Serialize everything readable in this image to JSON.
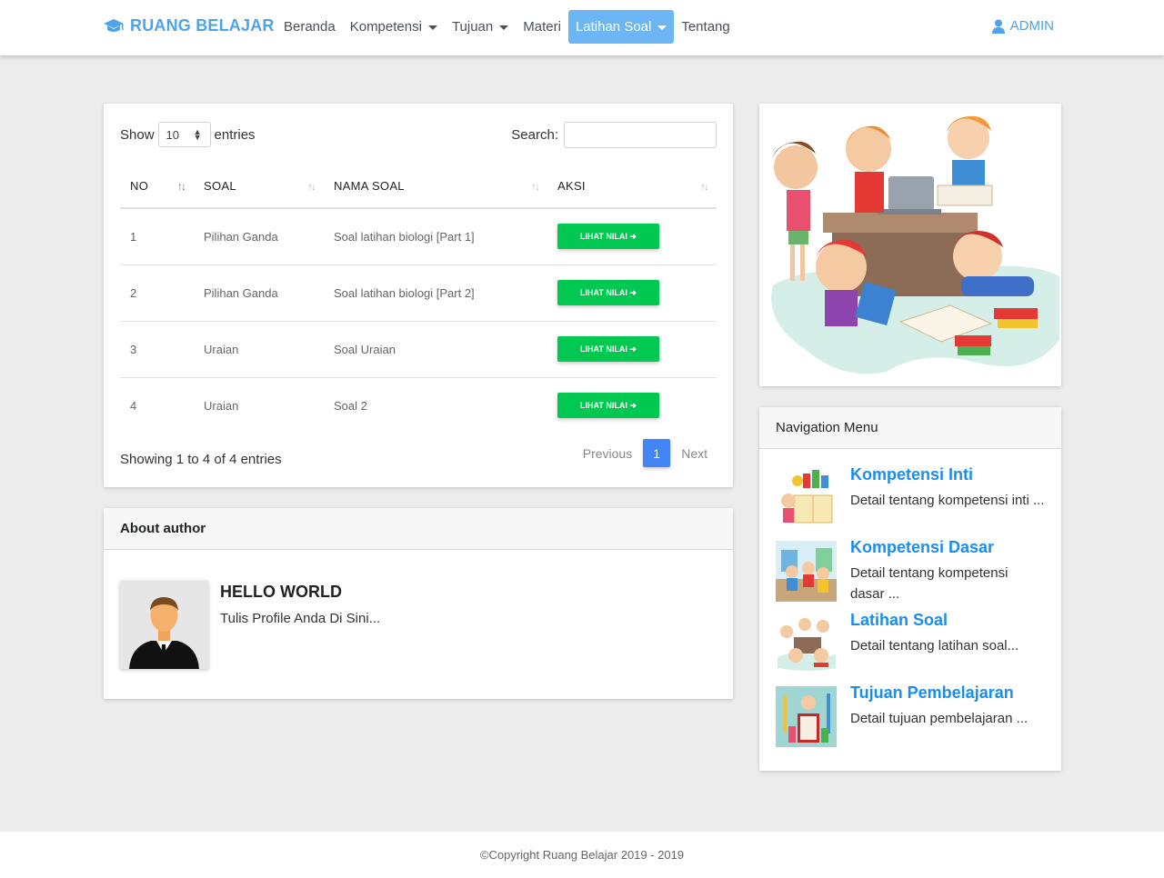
{
  "navbar": {
    "brand": "RUANG BELAJAR",
    "items": [
      {
        "label": "Beranda"
      },
      {
        "label": "Kompetensi"
      },
      {
        "label": "Tujuan"
      },
      {
        "label": "Materi"
      },
      {
        "label": "Latihan Soal"
      },
      {
        "label": "Tentang"
      }
    ],
    "user": "ADMIN"
  },
  "table_card": {
    "show_label": "Show",
    "entries_label": "entries",
    "page_length": "10",
    "search_label": "Search:",
    "search_value": "",
    "columns": [
      "NO",
      "SOAL",
      "NAMA SOAL",
      "AKSI"
    ],
    "rows": [
      {
        "no": "1",
        "soal": "Pilihan Ganda",
        "nama": "Soal latihan biologi [Part 1]",
        "aksi": "LIHAT NILAI"
      },
      {
        "no": "2",
        "soal": "Pilihan Ganda",
        "nama": "Soal latihan biologi [Part 2]",
        "aksi": "LIHAT NILAI"
      },
      {
        "no": "3",
        "soal": "Uraian",
        "nama": "Soal Uraian",
        "aksi": "LIHAT NILAI"
      },
      {
        "no": "4",
        "soal": "Uraian",
        "nama": "Soal 2",
        "aksi": "LIHAT NILAI"
      }
    ],
    "info": "Showing 1 to 4 of 4 entries",
    "pagination": {
      "previous": "Previous",
      "current": "1",
      "next": "Next"
    }
  },
  "author_card": {
    "header": "About author",
    "name": "HELLO WORLD",
    "description": "Tulis Profile Anda Di Sini..."
  },
  "nav_card": {
    "header": "Navigation Menu",
    "items": [
      {
        "title": "Kompetensi Inti",
        "desc": "Detail tentang kompetensi inti ..."
      },
      {
        "title": "Kompetensi Dasar",
        "desc": "Detail tentang kompetensi dasar ..."
      },
      {
        "title": "Latihan Soal",
        "desc": "Detail tentang latihan soal..."
      },
      {
        "title": "Tujuan Pembelajaran",
        "desc": "Detail tujuan pembelajaran ..."
      }
    ]
  },
  "footer": {
    "copyright": "©Copyright Ruang Belajar 2019 - 2019"
  },
  "colors": {
    "brand": "#4fa3ea",
    "active_nav": "#6cb6f5",
    "button": "#00c851",
    "page_active": "#4285f4",
    "link": "#1a8df0"
  }
}
